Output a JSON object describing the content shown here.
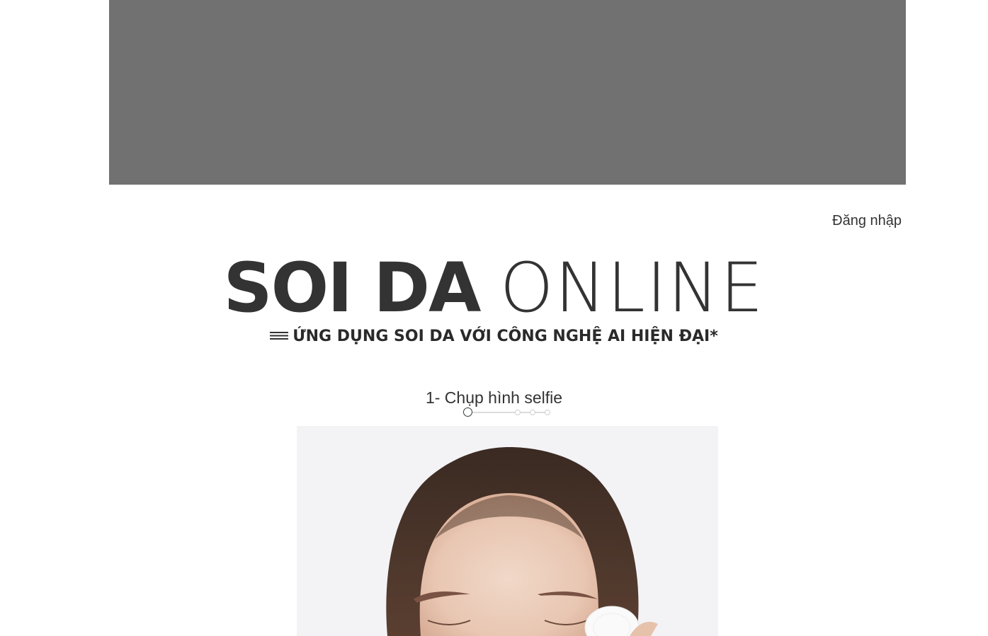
{
  "header": {
    "login_label": "Đăng nhập"
  },
  "hero": {
    "title_bold": "SOI DA",
    "title_light": "ONLINE",
    "subtitle": "ỨNG DỤNG SOI DA VỚI CÔNG NGHỆ AI HIỆN ĐẠI*"
  },
  "steps": {
    "current_label": "1- Chụp hình selfie",
    "total": 5,
    "current": 1
  },
  "colors": {
    "banner": "#717171",
    "text": "#333333",
    "accent": "#2f3a3a"
  }
}
